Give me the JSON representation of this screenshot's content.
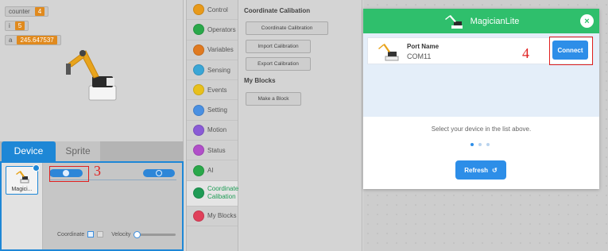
{
  "stage": {
    "monitors": [
      {
        "name": "counter",
        "value": "4"
      },
      {
        "name": "i",
        "value": "5"
      },
      {
        "name": "a",
        "value": "245.647537"
      }
    ]
  },
  "tabs": {
    "device": "Device",
    "sprite": "Sprite"
  },
  "device_panel": {
    "device_card_label": "Magici...",
    "annotation_3": "3",
    "coordinate_label": "Coordinate",
    "velocity_label": "Velocity"
  },
  "categories": [
    {
      "label": "Control",
      "color": "#e89a1a"
    },
    {
      "label": "Operators",
      "color": "#2aa84a"
    },
    {
      "label": "Variables",
      "color": "#e07a20"
    },
    {
      "label": "Sensing",
      "color": "#3aa6d6"
    },
    {
      "label": "Events",
      "color": "#e8c01c"
    },
    {
      "label": "Setting",
      "color": "#4a90e2"
    },
    {
      "label": "Motion",
      "color": "#8a5bd6"
    },
    {
      "label": "Status",
      "color": "#b14fc9"
    },
    {
      "label": "AI",
      "color": "#2aa84a"
    },
    {
      "label": "Coordinate Calibation",
      "color": "#1f9b55"
    },
    {
      "label": "My Blocks",
      "color": "#e0405a"
    }
  ],
  "palette": {
    "heading_calibration": "Coordinate Calibation",
    "btn_coordinate_calibration": "Coordinate Calibration",
    "btn_import_calibration": "Import Calibration",
    "btn_export_calibration": "Export Calibration",
    "heading_my_blocks": "My Blocks",
    "btn_make_block": "Make a Block"
  },
  "modal": {
    "title": "MagicianLite",
    "close_icon": "×",
    "port_name_label": "Port Name",
    "port_value": "COM11",
    "annotation_4": "4",
    "connect_label": "Connect",
    "instruction": "Select your device in the list above.",
    "refresh_label": "Refresh",
    "refresh_icon": "↺",
    "accent_color": "#2fbf6c",
    "button_color": "#2d8ee8"
  }
}
